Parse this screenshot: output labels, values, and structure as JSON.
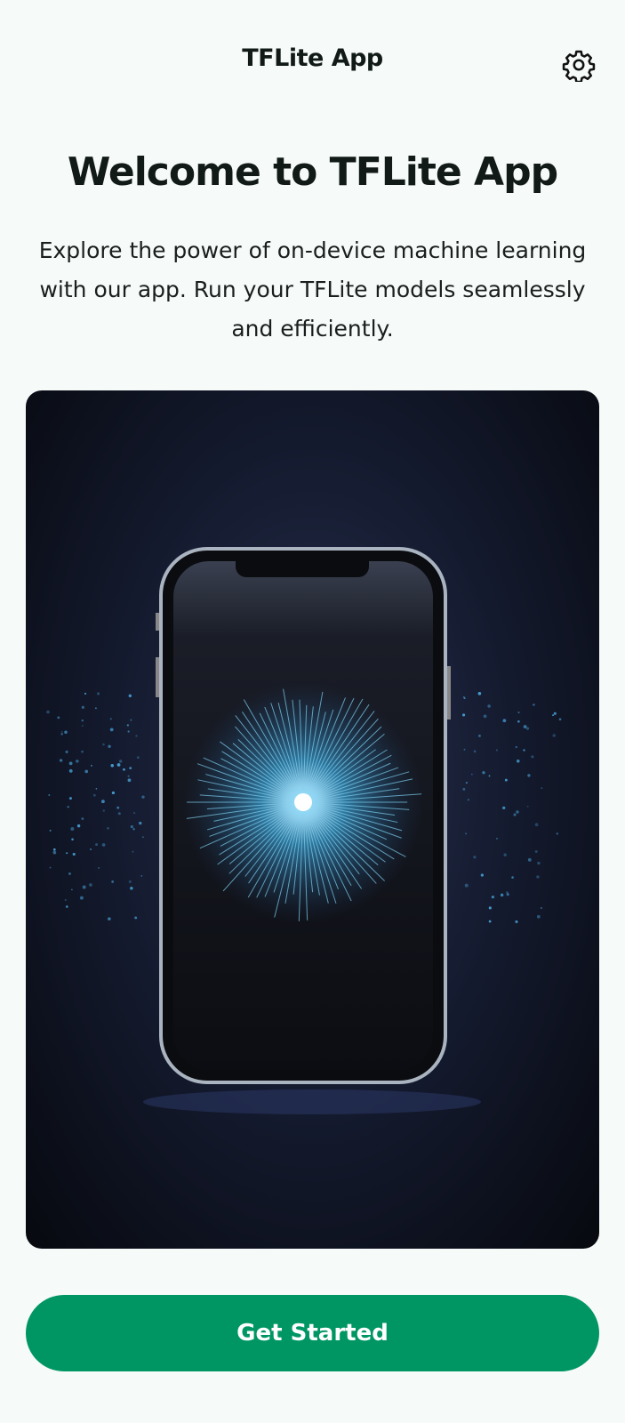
{
  "header": {
    "title": "TFLite App",
    "settings_icon": "gear-icon"
  },
  "hero": {
    "heading": "Welcome to TFLite App",
    "description": "Explore the power of on-device machine learning with our app. Run your TFLite models seamlessly and efficiently."
  },
  "cta": {
    "label": "Get Started",
    "color": "#009663"
  }
}
